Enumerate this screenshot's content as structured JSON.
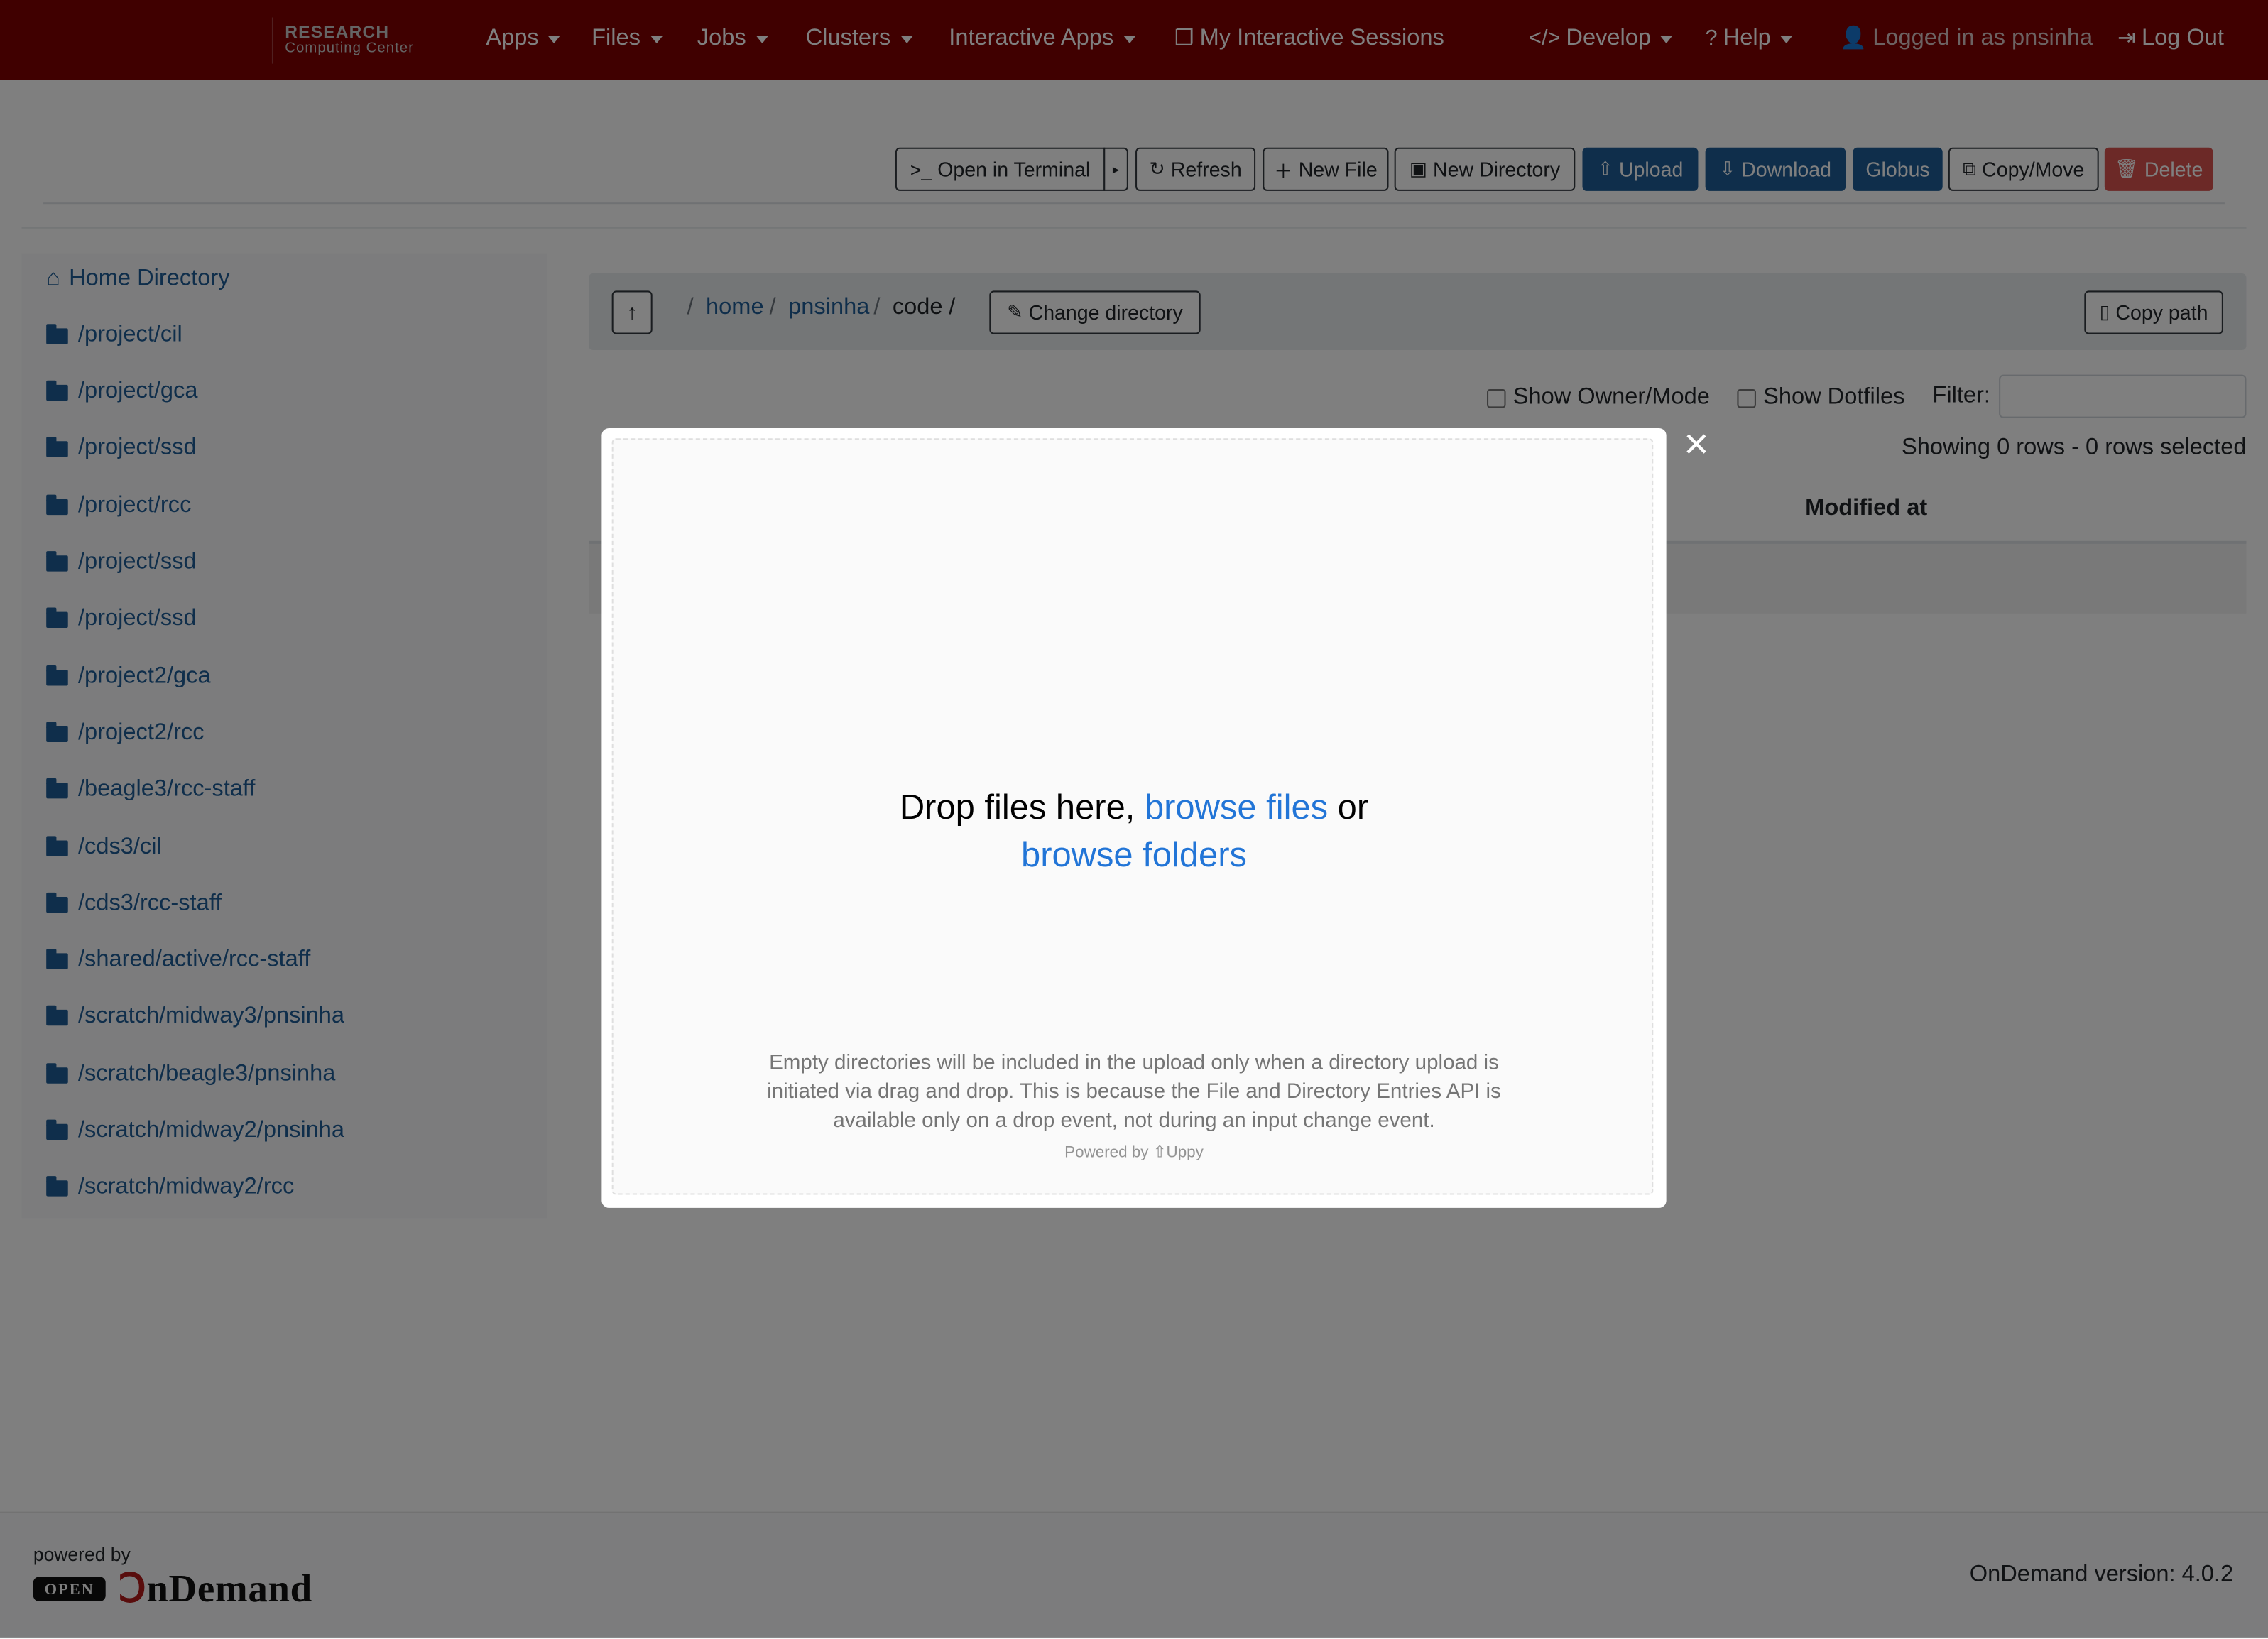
{
  "navbar": {
    "brand_line1": "RESEARCH",
    "brand_line2": "Computing Center",
    "items": [
      {
        "label": "Apps"
      },
      {
        "label": "Files"
      },
      {
        "label": "Jobs"
      },
      {
        "label": "Clusters"
      },
      {
        "label": "Interactive Apps"
      },
      {
        "label": "My Interactive Sessions"
      },
      {
        "label": "Develop"
      },
      {
        "label": "Help"
      },
      {
        "label": "Logged in as pnsinha"
      },
      {
        "label": "Log Out"
      }
    ]
  },
  "toolbar": {
    "open_terminal": "Open in Terminal",
    "refresh": "Refresh",
    "new_file": "New File",
    "new_directory": "New Directory",
    "upload": "Upload",
    "download": "Download",
    "globus": "Globus",
    "copy_move": "Copy/Move",
    "delete": "Delete"
  },
  "sidebar": {
    "home": "Home Directory",
    "items": [
      {
        "label": "/project/cil"
      },
      {
        "label": "/project/gca"
      },
      {
        "label": "/project/ssd"
      },
      {
        "label": "/project/rcc"
      },
      {
        "label": "/project/ssd"
      },
      {
        "label": "/project/ssd"
      },
      {
        "label": "/project2/gca"
      },
      {
        "label": "/project2/rcc"
      },
      {
        "label": "/beagle3/rcc-staff"
      },
      {
        "label": "/cds3/cil"
      },
      {
        "label": "/cds3/rcc-staff"
      },
      {
        "label": "/shared/active/rcc-staff"
      },
      {
        "label": "/scratch/midway3/pnsinha"
      },
      {
        "label": "/scratch/beagle3/pnsinha"
      },
      {
        "label": "/scratch/midway2/pnsinha"
      },
      {
        "label": "/scratch/midway2/rcc"
      }
    ]
  },
  "breadcrumb": {
    "root_sep": "/",
    "home": "home",
    "user": "pnsinha",
    "current": "code",
    "sep": "/",
    "change_directory": "Change directory",
    "copy_path": "Copy path"
  },
  "table": {
    "show_owner_mode": "Show Owner/Mode",
    "show_dotfiles": "Show Dotfiles",
    "filter_label": "Filter:",
    "filter_value": "",
    "rows_info": "Showing 0 rows - 0 rows selected",
    "col_modified": "Modified at"
  },
  "modal": {
    "drop_text": "Drop files here,",
    "browse_files": "browse files",
    "or": "or",
    "browse_folders": "browse folders",
    "note": "Empty directories will be included in the upload only when a directory upload is initiated via drag and drop. This is because the File and Directory Entries API is available only on a drop event, not during an input change event.",
    "powered_by": "Powered by",
    "uppy": "Uppy",
    "close": "×"
  },
  "footer": {
    "powered_by": "powered by",
    "open_badge": "OPEN",
    "logo_text": "nDemand",
    "version": "OnDemand version: 4.0.2"
  },
  "colors": {
    "navbar": "#800000",
    "primary": "#1f5d96",
    "danger": "#d9534f",
    "uppy_link": "#2275d7"
  }
}
